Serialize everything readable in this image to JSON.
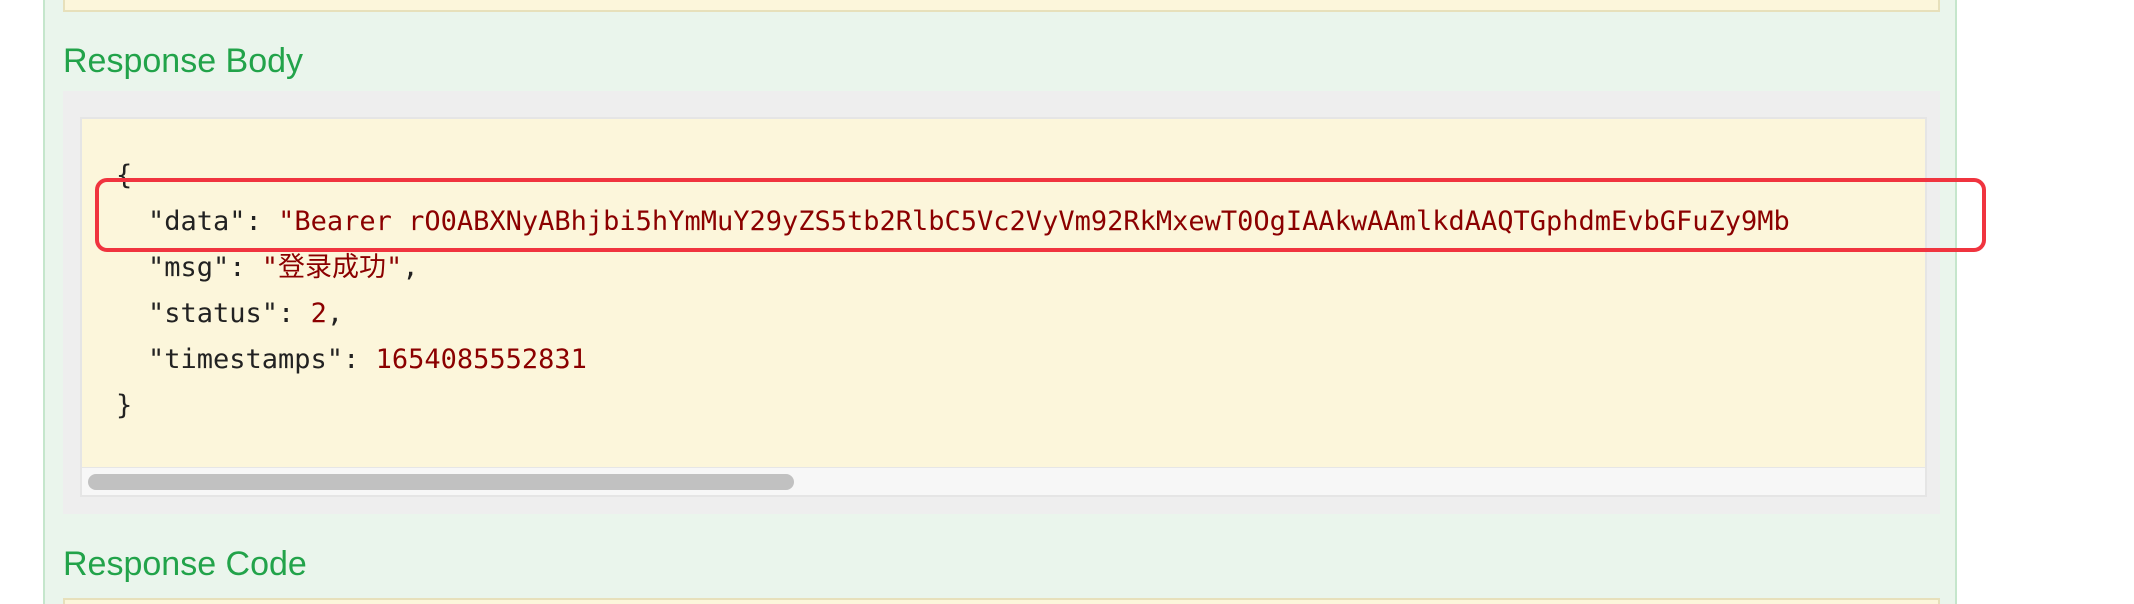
{
  "response_body": {
    "heading": "Response Body",
    "json_lines": {
      "open_brace": "{",
      "data_key": "\"data\"",
      "data_value": "\"Bearer rO0ABXNyABhjbi5hYmMuY29yZS5tb2RlbC5Vc2VyVm92RkMxewT0OgIAAkwAAmlkdAAQTGphdmEvbGFuZy9Mb",
      "msg_key": "\"msg\"",
      "msg_value": "\"登录成功\"",
      "status_key": "\"status\"",
      "status_value": "2",
      "timestamps_key": "\"timestamps\"",
      "timestamps_value": "1654085552831",
      "close_brace": "}"
    },
    "colon": ": ",
    "comma": ","
  },
  "response_code": {
    "heading": "Response Code"
  },
  "colors": {
    "heading_green": "#22a34a",
    "panel_green": "#eaf5ec",
    "code_bg": "#fcf6db",
    "string_red": "#8b0000",
    "highlight_red": "#f0343f"
  }
}
